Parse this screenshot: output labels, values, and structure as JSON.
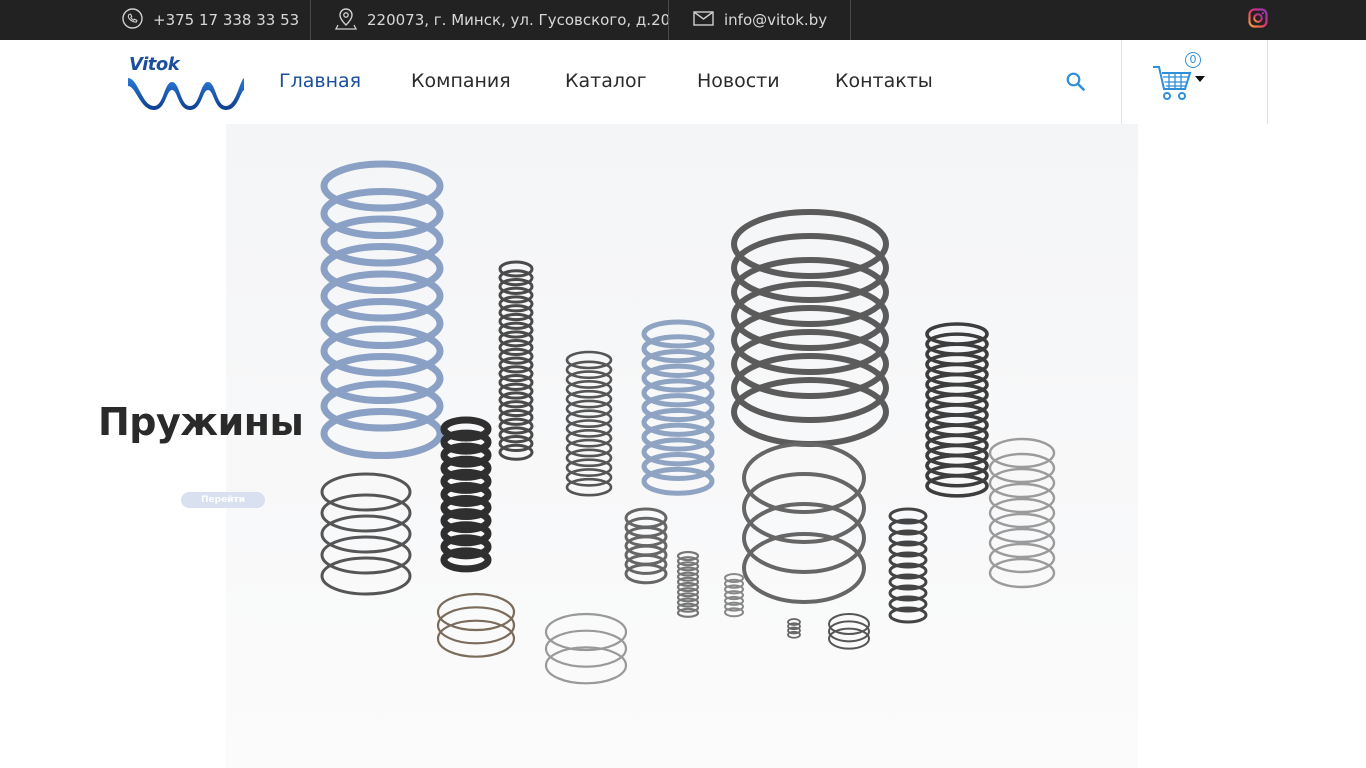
{
  "topbar": {
    "phone": "+375 17 338 33 53",
    "address": "220073, г. Минск, ул. Гусовского, д.20",
    "email": "info@vitok.by",
    "phone_icon": "phone-icon",
    "address_icon": "map-pin-icon",
    "email_icon": "mail-icon",
    "social_icon": "instagram-icon"
  },
  "header": {
    "logo_text": "Vitok",
    "nav": [
      {
        "label": "Главная"
      },
      {
        "label": "Компания"
      },
      {
        "label": "Каталог"
      },
      {
        "label": "Новости"
      },
      {
        "label": "Контакты"
      }
    ],
    "search_icon": "search-icon",
    "cart_icon": "cart-icon",
    "cart_count": "0"
  },
  "hero": {
    "title": "Пружины",
    "button_label": "Перейти"
  },
  "colors": {
    "topbar_bg": "#222222",
    "accent": "#1b4f9c",
    "link_blue": "#2f8fd8"
  }
}
